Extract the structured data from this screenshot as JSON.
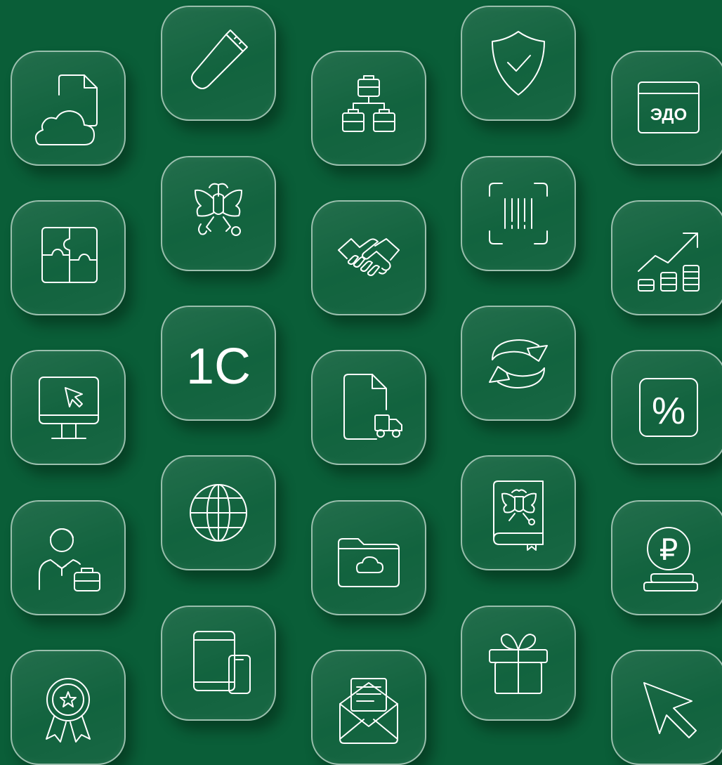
{
  "colors": {
    "background": "#0a5e38",
    "tile_border": "#ecf5ef",
    "icon_stroke": "#ffffff"
  },
  "tiles": [
    {
      "icon": "cloud-document-icon"
    },
    {
      "icon": "usb-flash-drive-icon"
    },
    {
      "icon": "briefcases-structure-icon"
    },
    {
      "icon": "shield-check-icon"
    },
    {
      "icon": "edo-window-icon",
      "label": "ЭДО"
    },
    {
      "icon": "puzzle-icon"
    },
    {
      "icon": "coat-of-arms-eagle-icon"
    },
    {
      "icon": "handshake-icon"
    },
    {
      "icon": "barcode-scan-icon"
    },
    {
      "icon": "growth-chart-coins-icon"
    },
    {
      "icon": "monitor-cursor-icon"
    },
    {
      "icon": "logo-1c-icon",
      "label": "1C"
    },
    {
      "icon": "document-delivery-truck-icon"
    },
    {
      "icon": "sync-arrows-icon"
    },
    {
      "icon": "percent-icon",
      "label": "%"
    },
    {
      "icon": "employee-briefcase-icon"
    },
    {
      "icon": "globe-icon"
    },
    {
      "icon": "cloud-folder-icon"
    },
    {
      "icon": "coat-of-arms-book-icon"
    },
    {
      "icon": "ruble-coins-icon",
      "label": "₽"
    },
    {
      "icon": "award-star-icon"
    },
    {
      "icon": "tablet-phone-icon"
    },
    {
      "icon": "email-envelope-icon"
    },
    {
      "icon": "gift-box-icon"
    },
    {
      "icon": "cursor-arrow-icon"
    }
  ]
}
